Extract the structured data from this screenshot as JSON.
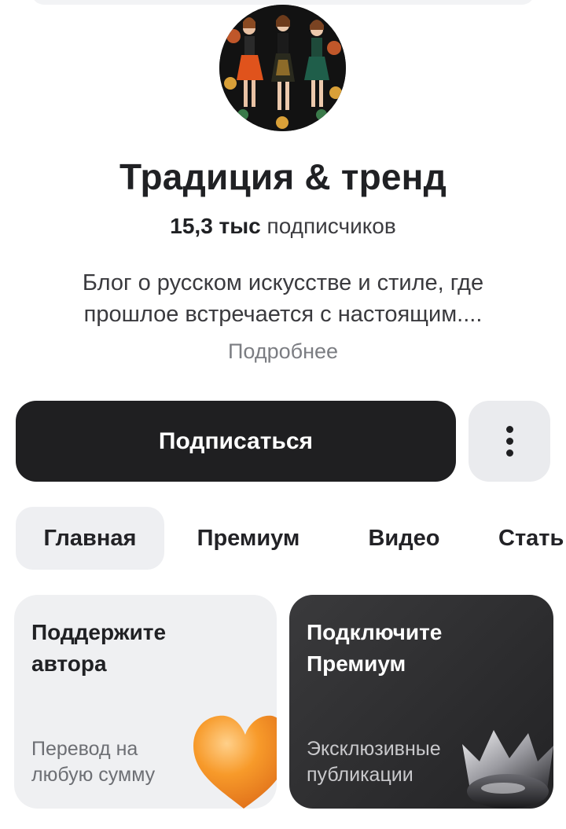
{
  "channel": {
    "title": "Традиция & тренд",
    "subscribers_count": "15,3 тыс",
    "subscribers_label": "подписчиков",
    "description": "Блог о русском искусстве и стиле, где прошлое встречается с настоящим....",
    "more_label": "Подробнее"
  },
  "actions": {
    "subscribe_label": "Подписаться",
    "menu_icon": "more-vertical-icon"
  },
  "tabs": [
    {
      "label": "Главная",
      "active": true
    },
    {
      "label": "Премиум",
      "active": false
    },
    {
      "label": "Видео",
      "active": false
    },
    {
      "label": "Стать",
      "active": false
    }
  ],
  "cards": {
    "support": {
      "title": "Поддержите автора",
      "subtitle": "Перевод на любую сумму",
      "icon": "heart-icon"
    },
    "premium": {
      "title": "Подключите Премиум",
      "subtitle": "Эксклюзивные публикации",
      "icon": "crown-icon"
    }
  },
  "colors": {
    "primary_button": "#1f1f21",
    "secondary_button": "#eaebee",
    "active_tab": "#eeeff2",
    "heart": "#f59a2b"
  }
}
